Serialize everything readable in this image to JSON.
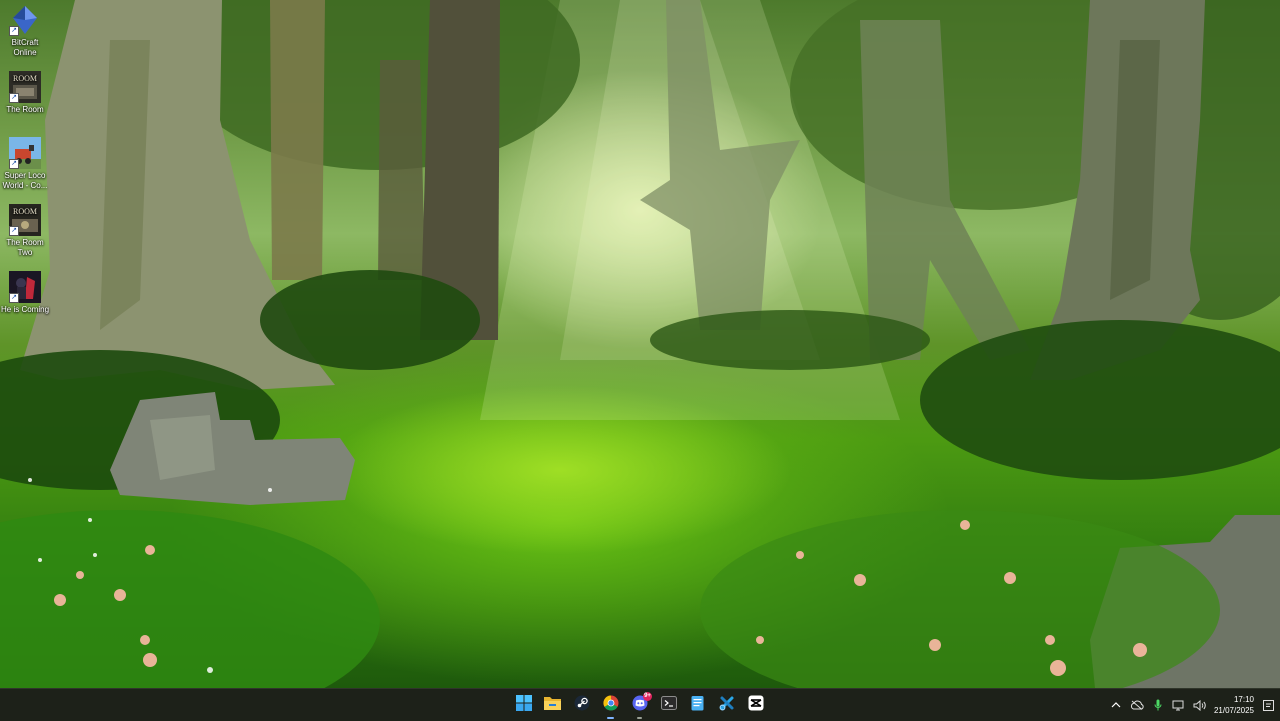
{
  "desktop": {
    "icons": [
      {
        "label": "BitCraft Online",
        "icon": "bitcraft-icon"
      },
      {
        "label": "The Room",
        "icon": "the-room-icon"
      },
      {
        "label": "Super Loco World - Co...",
        "icon": "super-loco-world-icon"
      },
      {
        "label": "The Room Two",
        "icon": "the-room-two-icon"
      },
      {
        "label": "He is Coming",
        "icon": "he-is-coming-icon"
      }
    ],
    "room_logo": "ROOM"
  },
  "taskbar": {
    "apps": [
      {
        "name": "Start",
        "icon": "windows-start-icon"
      },
      {
        "name": "File Explorer",
        "icon": "file-explorer-icon"
      },
      {
        "name": "Steam",
        "icon": "steam-icon"
      },
      {
        "name": "Google Chrome",
        "icon": "chrome-icon",
        "active": true
      },
      {
        "name": "Discord",
        "icon": "discord-icon",
        "badge": "9+"
      },
      {
        "name": "Terminal",
        "icon": "terminal-icon"
      },
      {
        "name": "Notepad",
        "icon": "notepad-icon"
      },
      {
        "name": "Snipping Tool",
        "icon": "snipping-tool-icon"
      },
      {
        "name": "CapCut",
        "icon": "capcut-icon"
      }
    ],
    "tray": {
      "time": "17:10",
      "date": "21/07/2025"
    }
  },
  "colors": {
    "taskbar_bg": "#1d2119",
    "active_indicator": "#7fb4ff",
    "discord_badge": "#e0245e"
  }
}
